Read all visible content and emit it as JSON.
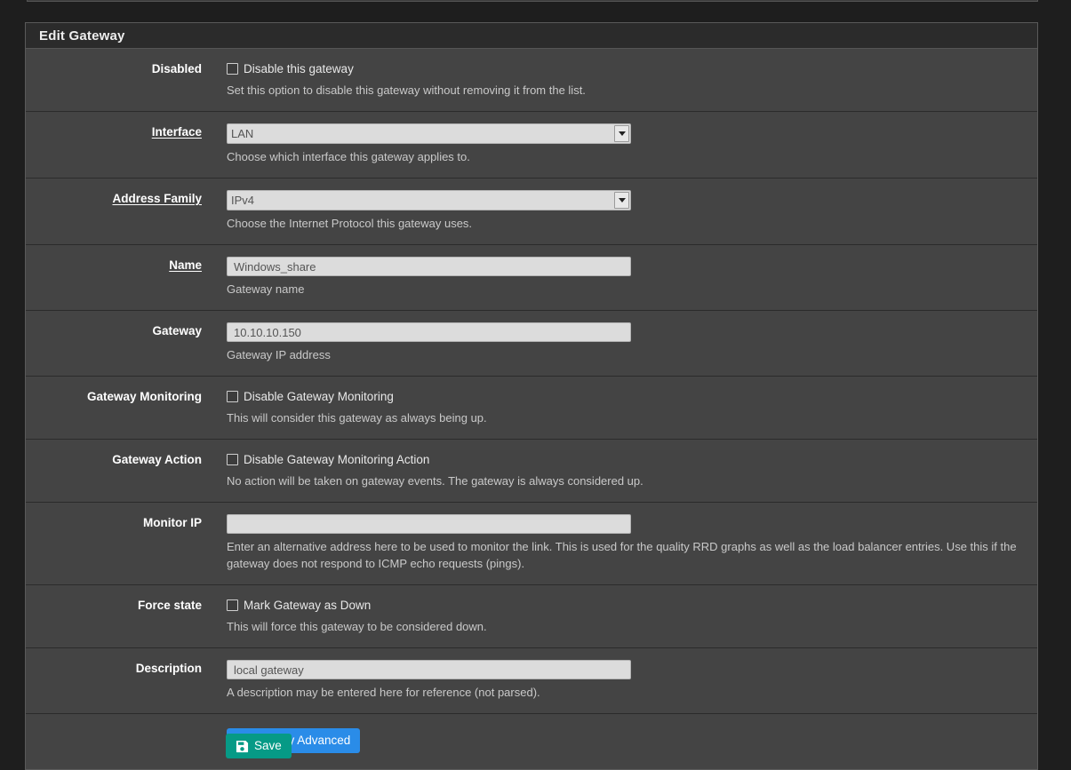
{
  "panel": {
    "title": "Edit Gateway"
  },
  "fields": {
    "disabled": {
      "label": "Disabled",
      "checkbox_label": "Disable this gateway",
      "help": "Set this option to disable this gateway without removing it from the list.",
      "checked": false
    },
    "interface": {
      "label": "Interface",
      "value": "LAN",
      "options": [
        "LAN"
      ],
      "help": "Choose which interface this gateway applies to."
    },
    "address_family": {
      "label": "Address Family",
      "value": "IPv4",
      "options": [
        "IPv4"
      ],
      "help": "Choose the Internet Protocol this gateway uses."
    },
    "name": {
      "label": "Name",
      "value": "Windows_share",
      "help": "Gateway name"
    },
    "gateway": {
      "label": "Gateway",
      "value": "10.10.10.150",
      "help": "Gateway IP address"
    },
    "gateway_monitoring": {
      "label": "Gateway Monitoring",
      "checkbox_label": "Disable Gateway Monitoring",
      "help": "This will consider this gateway as always being up.",
      "checked": false
    },
    "gateway_action": {
      "label": "Gateway Action",
      "checkbox_label": "Disable Gateway Monitoring Action",
      "help": "No action will be taken on gateway events. The gateway is always considered up.",
      "checked": false
    },
    "monitor_ip": {
      "label": "Monitor IP",
      "value": "",
      "help": "Enter an alternative address here to be used to monitor the link. This is used for the quality RRD graphs as well as the load balancer entries. Use this if the gateway does not respond to ICMP echo requests (pings)."
    },
    "force_state": {
      "label": "Force state",
      "checkbox_label": "Mark Gateway as Down",
      "help": "This will force this gateway to be considered down.",
      "checked": false
    },
    "description": {
      "label": "Description",
      "value": "local gateway",
      "help": "A description may be entered here for reference (not parsed)."
    }
  },
  "buttons": {
    "display_advanced": {
      "label": "Display Advanced",
      "icon": "gear-icon",
      "color": "#2a8ce8"
    },
    "save": {
      "label": "Save",
      "icon": "floppy-save-icon",
      "color": "#069a86"
    }
  }
}
